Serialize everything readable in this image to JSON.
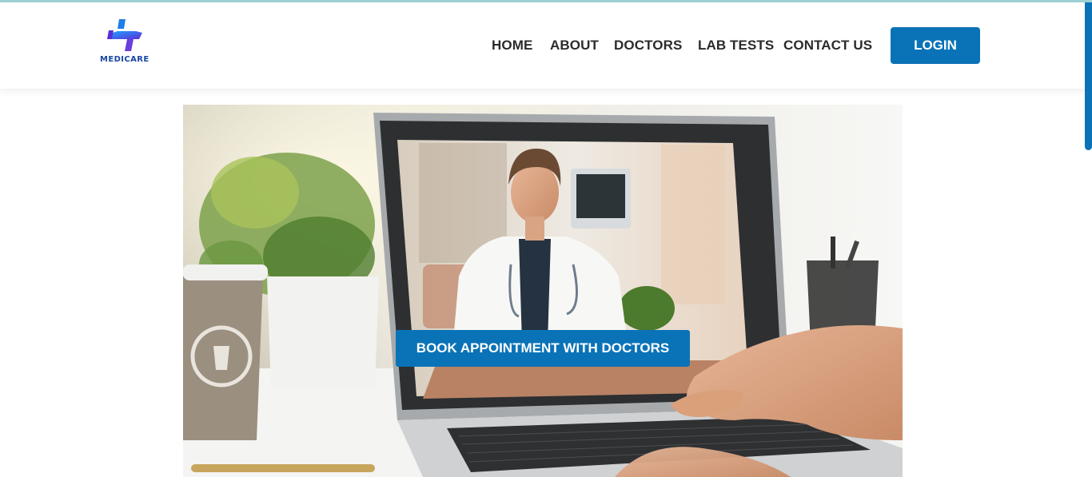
{
  "brand": {
    "name": "MEDICARE"
  },
  "nav": {
    "items": [
      {
        "label": "HOME"
      },
      {
        "label": "ABOUT"
      },
      {
        "label": "DOCTORS"
      },
      {
        "label": "LAB TESTS"
      },
      {
        "label": "CONTACT US"
      }
    ],
    "login_label": "LOGIN"
  },
  "hero": {
    "cta_label": "BOOK APPOINTMENT WITH DOCTORS"
  },
  "colors": {
    "primary": "#0a73b7",
    "brand_purple": "#6b3fd9",
    "brand_blue": "#1f7ee8"
  }
}
